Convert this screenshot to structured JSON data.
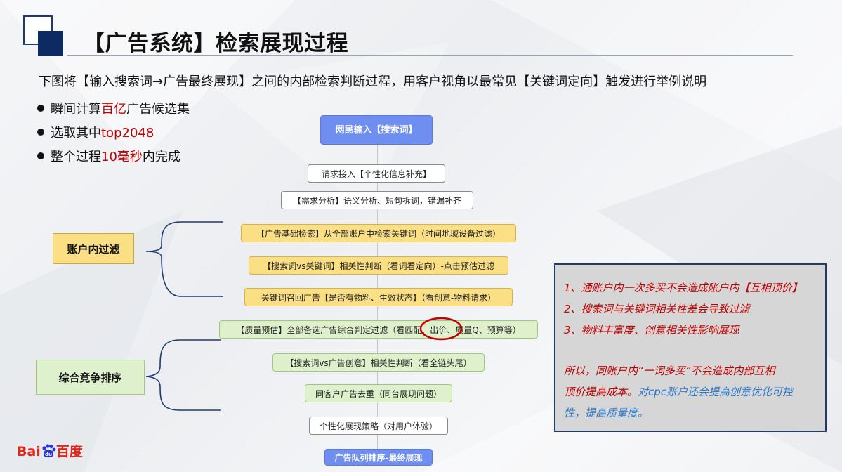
{
  "title": "【广告系统】检索展现过程",
  "intro": "下图将【输入搜索词→广告最终展现】之间的内部检索判断过程，用客户视角以最常见【关键词定向】触发进行举例说明",
  "bullets": [
    {
      "pre": "瞬间计算",
      "hl": "百亿",
      "post": "广告候选集"
    },
    {
      "pre": "选取其中",
      "hl": "top2048",
      "post": ""
    },
    {
      "pre": "整个过程",
      "hl": "10毫秒",
      "post": "内完成"
    }
  ],
  "flow": [
    {
      "text": "网民输入【搜索词】",
      "style": "blue"
    },
    {
      "text": "请求接入【个性化信息补充】",
      "style": "white"
    },
    {
      "text": "【需求分析】语义分析、短句拆词，错漏补齐",
      "style": "white"
    },
    {
      "text": "【广告基础检索】从全部账户中检索关键词（时间地域设备过滤）",
      "style": "yellow"
    },
    {
      "text": "【搜索词vs关键词】相关性判断（看词看定向）-点击预估过滤",
      "style": "yellow"
    },
    {
      "text": "关键词召回广告【是否有物料、生效状态】（看创意-物料请求）",
      "style": "yellow"
    },
    {
      "text": "【质量预估】全部备选广告综合判定过滤（看匹配、出价、质量Q、预算等）",
      "style": "green"
    },
    {
      "text": "【搜索词vs广告创意】相关性判断（看全链头尾）",
      "style": "green"
    },
    {
      "text": "同客户广告去重（同台展现问题）",
      "style": "green"
    },
    {
      "text": "个性化展现策略（对用户体验）",
      "style": "white"
    },
    {
      "text": "广告队列排序-最终展现",
      "style": "blue"
    }
  ],
  "labels": {
    "account_filter": "账户内过滤",
    "competition": "综合竞争排序"
  },
  "note": {
    "line1": "1、通账户内一次多买不会造成账户内【互相顶价】",
    "line2": "2、搜索词与关键词相关性差会导致过滤",
    "line3": "3、物料丰富度、创意相关性影响展现",
    "line4": "所以，同账户内“一词多买”不会造成内部互相",
    "line5a": "顶价提高成本。",
    "line5b": "对cpc账户还会提高创意优化可控",
    "line6": "性，提高质量度。"
  },
  "logo": {
    "bai": "Bai",
    "du": "du",
    "baidu_cn": "百度"
  },
  "colors": {
    "accent_navy": "#0d2a63",
    "highlight_red": "#c00000",
    "note_blue": "#2e78c7",
    "flow_blue": "#6f8ff0",
    "flow_yellow": "#fbdf84",
    "flow_green": "#dff1cc"
  }
}
